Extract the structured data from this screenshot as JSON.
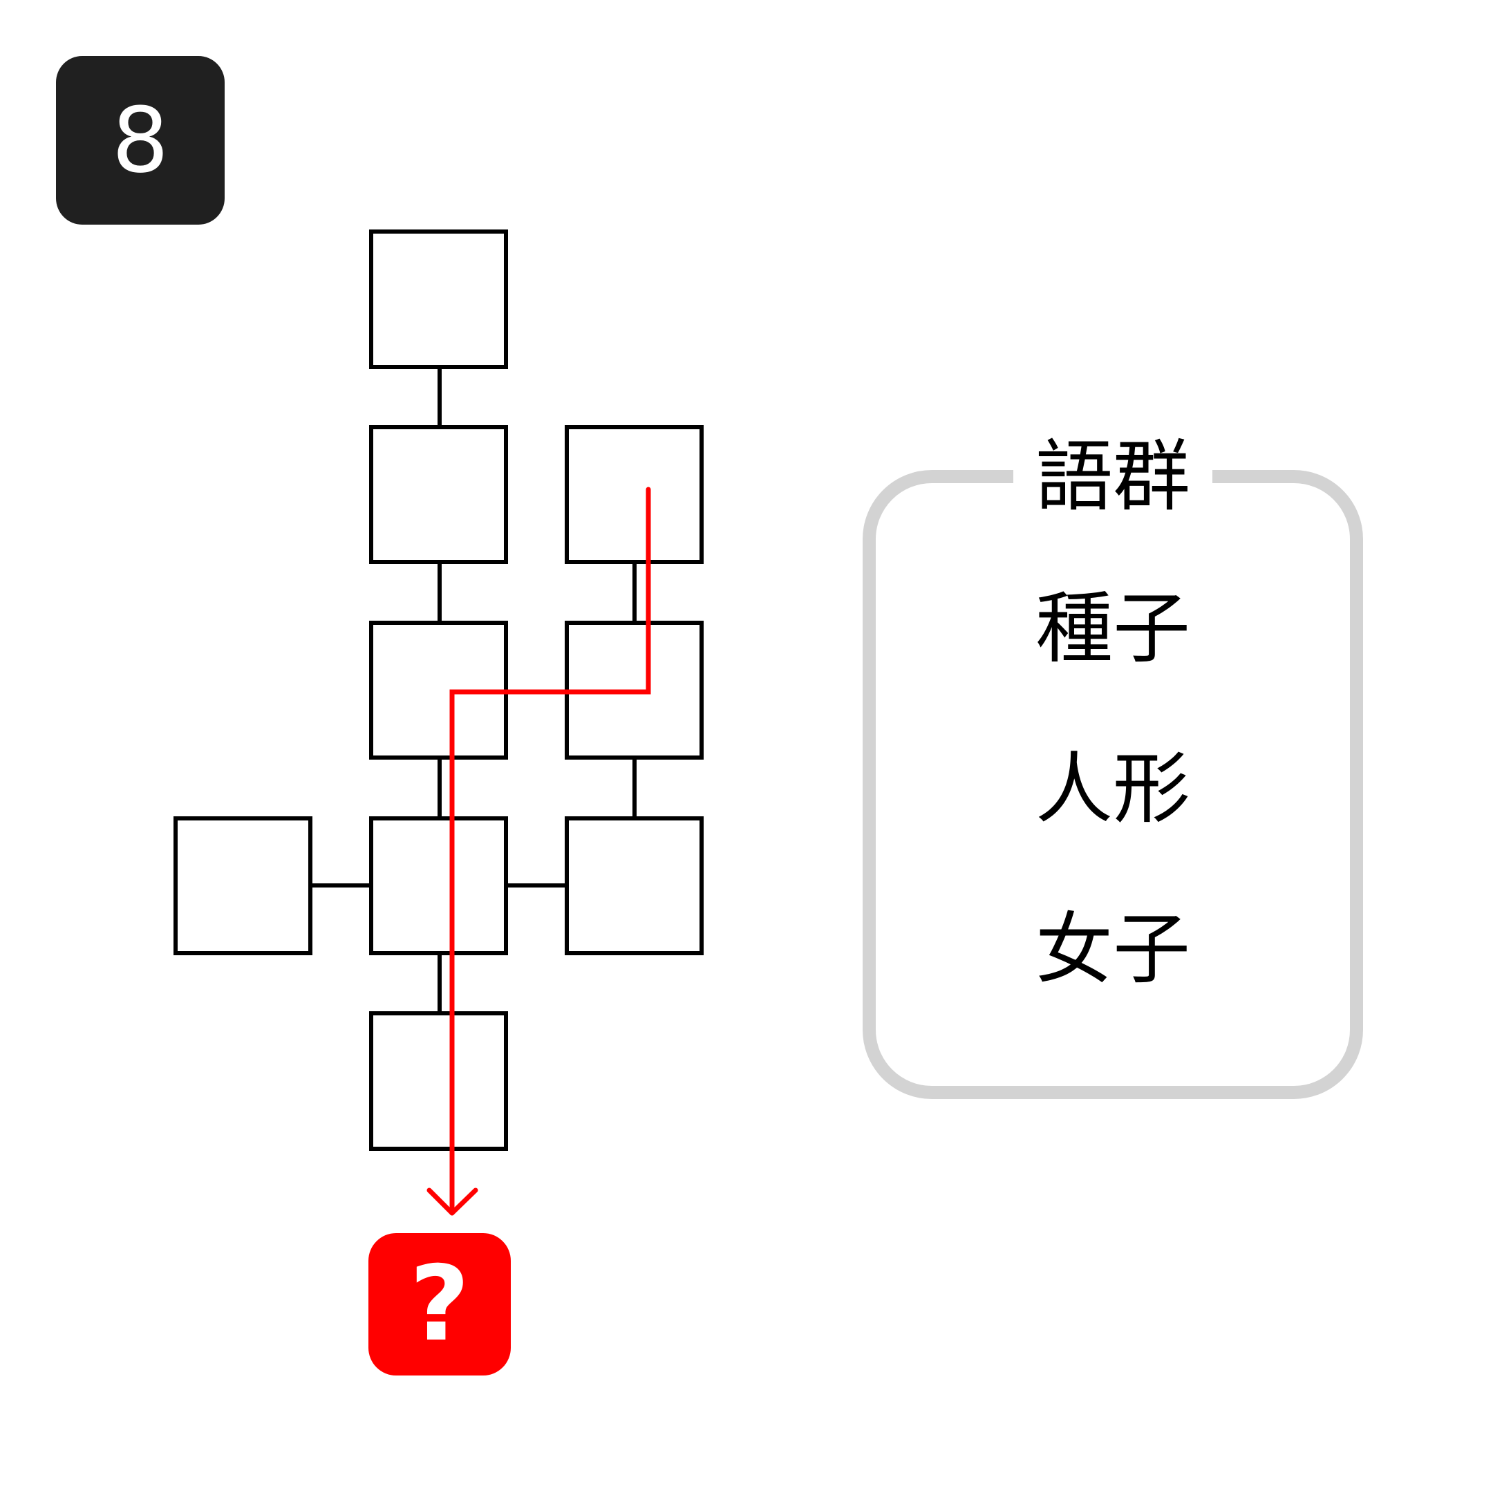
{
  "puzzle_number": "8",
  "word_panel": {
    "title": "語群",
    "words": [
      "種子",
      "人形",
      "女子"
    ]
  },
  "answer_marker": "?",
  "colors": {
    "badge_background": "#202020",
    "arrow": "#ff0000",
    "answer_box": "#ff0000",
    "panel_border": "#d3d3d3",
    "cell_border": "#000000"
  }
}
